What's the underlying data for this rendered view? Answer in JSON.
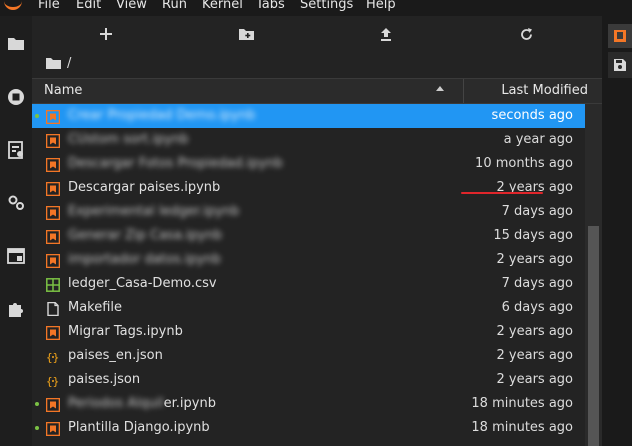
{
  "menu": [
    "File",
    "Edit",
    "View",
    "Run",
    "Kernel",
    "Tabs",
    "Settings",
    "Help"
  ],
  "colors": {
    "notebook_icon": "#f37626",
    "json_icon": "#f3a51a",
    "csv_icon": "#7bc144",
    "selected_row": "#2196f3",
    "running_dot": "#7bc144",
    "annotation_underline": "#e0262b"
  },
  "leftbar_icons": [
    "folder-icon",
    "stop-circle-icon",
    "command-palette-icon",
    "gears-icon",
    "tabs-icon",
    "extension-icon"
  ],
  "toolbar": {
    "new_launcher": "+",
    "new_folder": "new-folder-icon",
    "upload": "upload-icon",
    "refresh": "refresh-icon"
  },
  "breadcrumb": {
    "path": "/"
  },
  "header": {
    "name": "Name",
    "modified": "Last Modified"
  },
  "files": [
    {
      "name": "Crear Propiedad Demo.ipynb",
      "type": "notebook",
      "modified": "seconds ago",
      "running": true,
      "selected": true,
      "blurred": true
    },
    {
      "name": "CUstom sort.ipynb",
      "type": "notebook",
      "modified": "a year ago",
      "running": false,
      "selected": false,
      "blurred": true
    },
    {
      "name": "Descargar Fotos Propiedad.ipynb",
      "type": "notebook",
      "modified": "10 months ago",
      "running": false,
      "selected": false,
      "blurred": true
    },
    {
      "name": "Descargar paises.ipynb",
      "type": "notebook",
      "modified": "2 years ago",
      "running": false,
      "selected": false,
      "blurred": false
    },
    {
      "name": "Experimental ledger.ipynb",
      "type": "notebook",
      "modified": "7 days ago",
      "running": false,
      "selected": false,
      "blurred": true
    },
    {
      "name": "Generar Zip Casa.ipynb",
      "type": "notebook",
      "modified": "15 days ago",
      "running": false,
      "selected": false,
      "blurred": true
    },
    {
      "name": "importador datos.ipynb",
      "type": "notebook",
      "modified": "2 years ago",
      "running": false,
      "selected": false,
      "blurred": true
    },
    {
      "name": "ledger_Casa-Demo.csv",
      "type": "csv",
      "modified": "7 days ago",
      "running": false,
      "selected": false,
      "blurred": false
    },
    {
      "name": "Makefile",
      "type": "file",
      "modified": "6 days ago",
      "running": false,
      "selected": false,
      "blurred": false
    },
    {
      "name": "Migrar Tags.ipynb",
      "type": "notebook",
      "modified": "2 years ago",
      "running": false,
      "selected": false,
      "blurred": false
    },
    {
      "name": "paises_en.json",
      "type": "json",
      "modified": "2 years ago",
      "running": false,
      "selected": false,
      "blurred": false
    },
    {
      "name": "paises.json",
      "type": "json",
      "modified": "2 years ago",
      "running": false,
      "selected": false,
      "blurred": false
    },
    {
      "name_blurred": "Periodos Alquil",
      "name_clear": "er.ipynb",
      "name": "Periodos Alquiler.ipynb",
      "type": "notebook",
      "modified": "18 minutes ago",
      "running": true,
      "selected": false,
      "blurred": "partial"
    },
    {
      "name": "Plantilla Django.ipynb",
      "type": "notebook",
      "modified": "18 minutes ago",
      "running": true,
      "selected": false,
      "blurred": false
    }
  ]
}
